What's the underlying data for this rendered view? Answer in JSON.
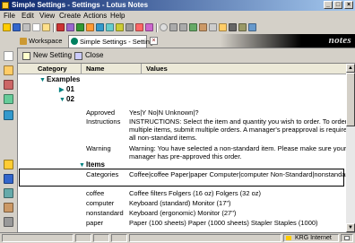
{
  "window": {
    "title": "Simple Settings - Settings - Lotus Notes"
  },
  "menu": [
    "File",
    "Edit",
    "View",
    "Create",
    "Actions",
    "Help"
  ],
  "tabs": {
    "workspace": "Workspace",
    "active": "Simple Settings - Settings"
  },
  "brand": "notes",
  "actions": {
    "new_setting": "New Setting",
    "close": "Close"
  },
  "columns": {
    "category": "Category",
    "name": "Name",
    "values": "Values"
  },
  "view": {
    "examples_label": "Examples",
    "sub_01": "01",
    "sub_02": "02",
    "items_label": "Items",
    "rows": [
      {
        "name": "Approved",
        "value": "Yes|Y No|N Unknown|?"
      },
      {
        "name": "Instructions",
        "value": "INSTRUCTIONS:  Select the item and quantity you wish to order. To order multiple items, submit multiple orders.   A manager's preapproval is required for all non-standard items."
      },
      {
        "name": "Warning",
        "value": "Warning: You have selected a non-standard item. Please make sure your manager has pre-approved this order."
      },
      {
        "name": "Categories",
        "value": "Coffee|coffee Paper|paper Computer|computer Non-Standard|nonstandard"
      },
      {
        "name": "coffee",
        "value": "Coffee filters  Folgers (16 oz)  Folgers (32 oz)"
      },
      {
        "name": "computer",
        "value": "Keyboard (standard)  Monitor (17\")"
      },
      {
        "name": "nonstandard",
        "value": "Keyboard (ergonomic)  Monitor (27\")"
      },
      {
        "name": "paper",
        "value": "Paper (100 sheets)  Paper (1000 sheets)  Stapler  Staples (1000)"
      }
    ]
  },
  "status": {
    "location": "KRG Internet"
  },
  "colors": {
    "titlebar_start": "#0a246a",
    "twisty": "#008080"
  }
}
